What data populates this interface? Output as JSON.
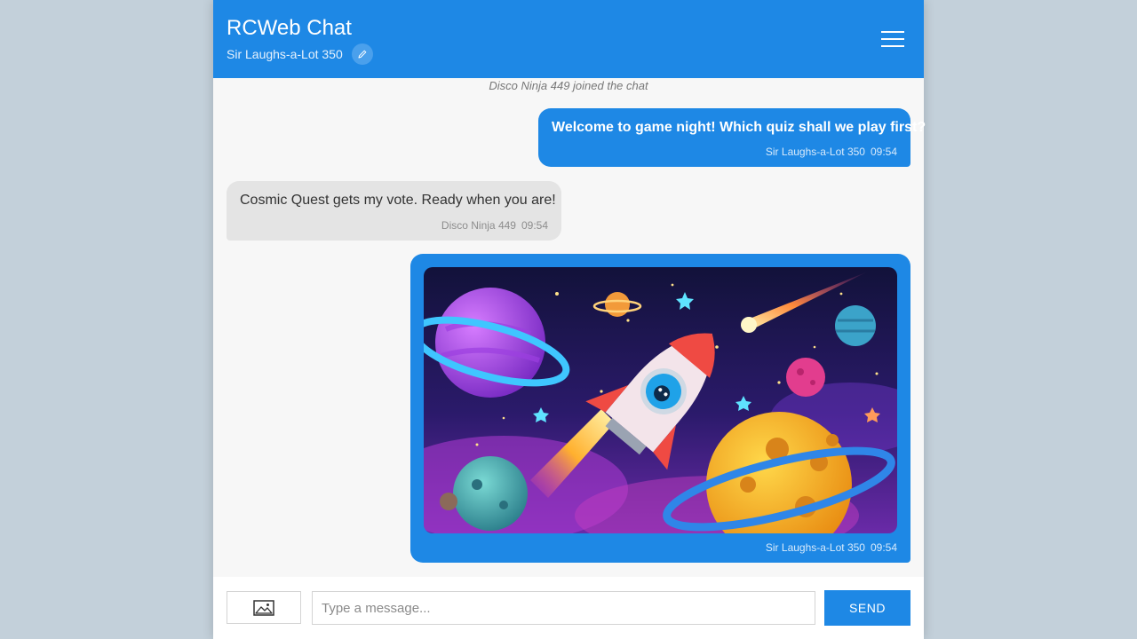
{
  "header": {
    "title": "RCWeb Chat",
    "user_name": "Sir Laughs-a-Lot 350",
    "edit_icon": "pencil-icon",
    "menu_icon": "hamburger-menu-icon",
    "color": "#1e88e5"
  },
  "chat": {
    "system_message": "Disco Ninja 449 joined the chat",
    "messages": [
      {
        "from": "me",
        "text": "Welcome to game night! Which quiz shall we play first?",
        "sender": "Sir Laughs-a-Lot 350",
        "time": "09:54"
      },
      {
        "from": "them",
        "text": "Cosmic Quest gets my vote. Ready when you are!",
        "sender": "Disco Ninja 449",
        "time": "09:54"
      },
      {
        "from": "me",
        "image": "cartoon space scene with rocket, planets and comets",
        "sender": "Sir Laughs-a-Lot 350",
        "time": "09:54"
      }
    ]
  },
  "composer": {
    "image_button_icon": "image-icon",
    "placeholder": "Type a message...",
    "value": "",
    "send_label": "SEND"
  }
}
